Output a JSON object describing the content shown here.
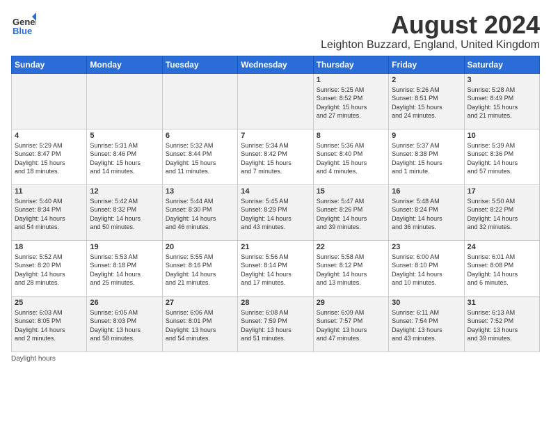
{
  "header": {
    "logo_general": "General",
    "logo_blue": "Blue",
    "month_year": "August 2024",
    "location": "Leighton Buzzard, England, United Kingdom"
  },
  "weekdays": [
    "Sunday",
    "Monday",
    "Tuesday",
    "Wednesday",
    "Thursday",
    "Friday",
    "Saturday"
  ],
  "weeks": [
    [
      {
        "day": "",
        "text": ""
      },
      {
        "day": "",
        "text": ""
      },
      {
        "day": "",
        "text": ""
      },
      {
        "day": "",
        "text": ""
      },
      {
        "day": "1",
        "text": "Sunrise: 5:25 AM\nSunset: 8:52 PM\nDaylight: 15 hours\nand 27 minutes."
      },
      {
        "day": "2",
        "text": "Sunrise: 5:26 AM\nSunset: 8:51 PM\nDaylight: 15 hours\nand 24 minutes."
      },
      {
        "day": "3",
        "text": "Sunrise: 5:28 AM\nSunset: 8:49 PM\nDaylight: 15 hours\nand 21 minutes."
      }
    ],
    [
      {
        "day": "4",
        "text": "Sunrise: 5:29 AM\nSunset: 8:47 PM\nDaylight: 15 hours\nand 18 minutes."
      },
      {
        "day": "5",
        "text": "Sunrise: 5:31 AM\nSunset: 8:46 PM\nDaylight: 15 hours\nand 14 minutes."
      },
      {
        "day": "6",
        "text": "Sunrise: 5:32 AM\nSunset: 8:44 PM\nDaylight: 15 hours\nand 11 minutes."
      },
      {
        "day": "7",
        "text": "Sunrise: 5:34 AM\nSunset: 8:42 PM\nDaylight: 15 hours\nand 7 minutes."
      },
      {
        "day": "8",
        "text": "Sunrise: 5:36 AM\nSunset: 8:40 PM\nDaylight: 15 hours\nand 4 minutes."
      },
      {
        "day": "9",
        "text": "Sunrise: 5:37 AM\nSunset: 8:38 PM\nDaylight: 15 hours\nand 1 minute."
      },
      {
        "day": "10",
        "text": "Sunrise: 5:39 AM\nSunset: 8:36 PM\nDaylight: 14 hours\nand 57 minutes."
      }
    ],
    [
      {
        "day": "11",
        "text": "Sunrise: 5:40 AM\nSunset: 8:34 PM\nDaylight: 14 hours\nand 54 minutes."
      },
      {
        "day": "12",
        "text": "Sunrise: 5:42 AM\nSunset: 8:32 PM\nDaylight: 14 hours\nand 50 minutes."
      },
      {
        "day": "13",
        "text": "Sunrise: 5:44 AM\nSunset: 8:30 PM\nDaylight: 14 hours\nand 46 minutes."
      },
      {
        "day": "14",
        "text": "Sunrise: 5:45 AM\nSunset: 8:29 PM\nDaylight: 14 hours\nand 43 minutes."
      },
      {
        "day": "15",
        "text": "Sunrise: 5:47 AM\nSunset: 8:26 PM\nDaylight: 14 hours\nand 39 minutes."
      },
      {
        "day": "16",
        "text": "Sunrise: 5:48 AM\nSunset: 8:24 PM\nDaylight: 14 hours\nand 36 minutes."
      },
      {
        "day": "17",
        "text": "Sunrise: 5:50 AM\nSunset: 8:22 PM\nDaylight: 14 hours\nand 32 minutes."
      }
    ],
    [
      {
        "day": "18",
        "text": "Sunrise: 5:52 AM\nSunset: 8:20 PM\nDaylight: 14 hours\nand 28 minutes."
      },
      {
        "day": "19",
        "text": "Sunrise: 5:53 AM\nSunset: 8:18 PM\nDaylight: 14 hours\nand 25 minutes."
      },
      {
        "day": "20",
        "text": "Sunrise: 5:55 AM\nSunset: 8:16 PM\nDaylight: 14 hours\nand 21 minutes."
      },
      {
        "day": "21",
        "text": "Sunrise: 5:56 AM\nSunset: 8:14 PM\nDaylight: 14 hours\nand 17 minutes."
      },
      {
        "day": "22",
        "text": "Sunrise: 5:58 AM\nSunset: 8:12 PM\nDaylight: 14 hours\nand 13 minutes."
      },
      {
        "day": "23",
        "text": "Sunrise: 6:00 AM\nSunset: 8:10 PM\nDaylight: 14 hours\nand 10 minutes."
      },
      {
        "day": "24",
        "text": "Sunrise: 6:01 AM\nSunset: 8:08 PM\nDaylight: 14 hours\nand 6 minutes."
      }
    ],
    [
      {
        "day": "25",
        "text": "Sunrise: 6:03 AM\nSunset: 8:05 PM\nDaylight: 14 hours\nand 2 minutes."
      },
      {
        "day": "26",
        "text": "Sunrise: 6:05 AM\nSunset: 8:03 PM\nDaylight: 13 hours\nand 58 minutes."
      },
      {
        "day": "27",
        "text": "Sunrise: 6:06 AM\nSunset: 8:01 PM\nDaylight: 13 hours\nand 54 minutes."
      },
      {
        "day": "28",
        "text": "Sunrise: 6:08 AM\nSunset: 7:59 PM\nDaylight: 13 hours\nand 51 minutes."
      },
      {
        "day": "29",
        "text": "Sunrise: 6:09 AM\nSunset: 7:57 PM\nDaylight: 13 hours\nand 47 minutes."
      },
      {
        "day": "30",
        "text": "Sunrise: 6:11 AM\nSunset: 7:54 PM\nDaylight: 13 hours\nand 43 minutes."
      },
      {
        "day": "31",
        "text": "Sunrise: 6:13 AM\nSunset: 7:52 PM\nDaylight: 13 hours\nand 39 minutes."
      }
    ]
  ],
  "footer": "Daylight hours"
}
